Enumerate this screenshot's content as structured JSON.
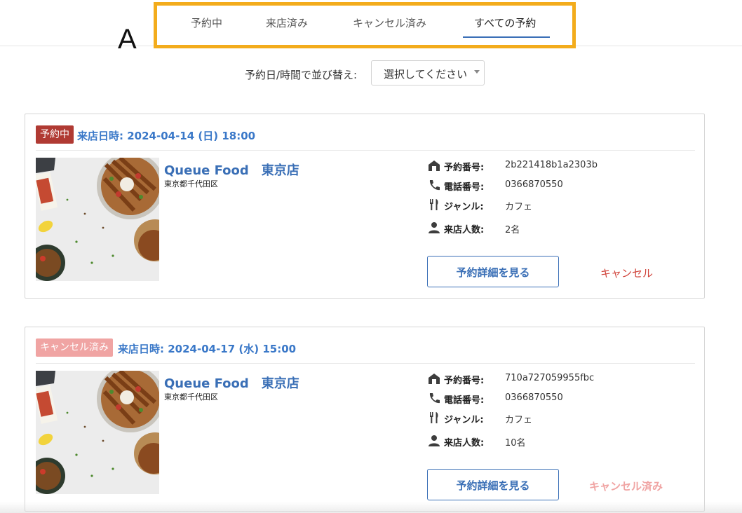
{
  "tabs": [
    {
      "label": "予約中"
    },
    {
      "label": "来店済み"
    },
    {
      "label": "キャンセル済み"
    },
    {
      "label": "すべての予約"
    }
  ],
  "annotation": "A",
  "sort": {
    "label": "予約日/時間で並び替え:",
    "selected": "選択してください"
  },
  "colors": {
    "accent": "#3a6fb6",
    "highlight_frame": "#f3ac1c",
    "badge_active": "#b03a33",
    "badge_cancelled": "#f0a4a3",
    "cancel": "#d0433a"
  },
  "reservations": [
    {
      "status": "予約中",
      "visit_date": "来店日時: 2024-04-14 (日) 18:00",
      "shop_name": "Queue Food　東京店",
      "address": "東京都千代田区",
      "info": {
        "reservation_no_label": "予約番号:",
        "reservation_no": "2b221418b1a2303b",
        "phone_label": "電話番号:",
        "phone": "0366870550",
        "genre_label": "ジャンル:",
        "genre": "カフェ",
        "party_label": "来店人数:",
        "party": "2名"
      },
      "detail_button": "予約詳細を見る",
      "action": "キャンセル"
    },
    {
      "status": "キャンセル済み",
      "visit_date": "来店日時: 2024-04-17 (水) 15:00",
      "shop_name": "Queue Food　東京店",
      "address": "東京都千代田区",
      "info": {
        "reservation_no_label": "予約番号:",
        "reservation_no": "710a727059955fbc",
        "phone_label": "電話番号:",
        "phone": "0366870550",
        "genre_label": "ジャンル:",
        "genre": "カフェ",
        "party_label": "来店人数:",
        "party": "10名"
      },
      "detail_button": "予約詳細を見る",
      "action": "キャンセル済み"
    }
  ]
}
